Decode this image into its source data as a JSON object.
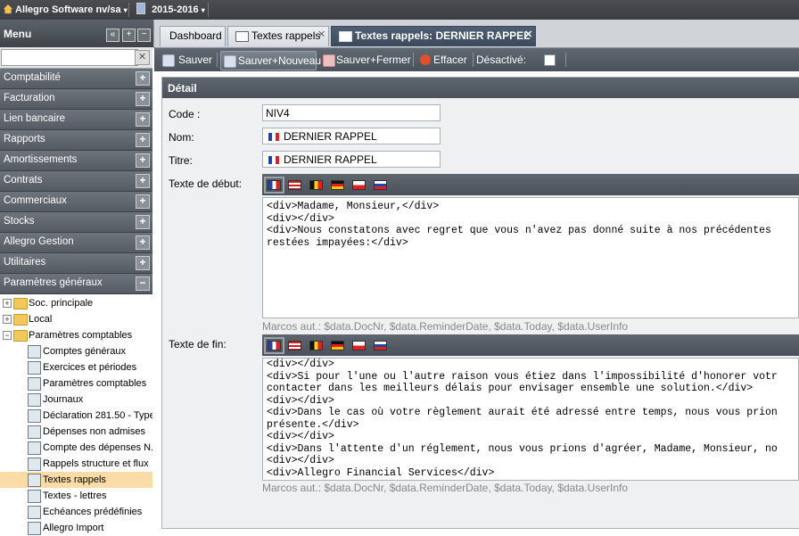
{
  "topbar": {
    "company": "Allegro Software nv/sa",
    "year": "2015-2016"
  },
  "menu": {
    "title": "Menu",
    "search_placeholder": "",
    "categories": [
      "Comptabilité",
      "Facturation",
      "Lien bancaire",
      "Rapports",
      "Amortissements",
      "Contrats",
      "Commerciaux",
      "Stocks",
      "Allegro Gestion",
      "Utilitaires",
      "Paramètres généraux"
    ],
    "tree": [
      {
        "label": "Soc. principale",
        "level": 0,
        "kind": "folder",
        "expander": "+"
      },
      {
        "label": "Local",
        "level": 0,
        "kind": "folder",
        "expander": "+"
      },
      {
        "label": "Paramètres comptables",
        "level": 0,
        "kind": "folder",
        "expander": "−"
      },
      {
        "label": "Comptes généraux",
        "level": 1,
        "kind": "leaf"
      },
      {
        "label": "Exercices et périodes",
        "level": 1,
        "kind": "leaf"
      },
      {
        "label": "Paramètres comptables",
        "level": 1,
        "kind": "leaf"
      },
      {
        "label": "Journaux",
        "level": 1,
        "kind": "leaf"
      },
      {
        "label": "Déclaration 281.50 - Type",
        "level": 1,
        "kind": "leaf"
      },
      {
        "label": "Dépenses non admises",
        "level": 1,
        "kind": "leaf"
      },
      {
        "label": "Compte des dépenses N.",
        "level": 1,
        "kind": "leaf"
      },
      {
        "label": "Rappels structure et flux",
        "level": 1,
        "kind": "leaf"
      },
      {
        "label": "Textes rappels",
        "level": 1,
        "kind": "leaf",
        "selected": true
      },
      {
        "label": "Textes - lettres",
        "level": 1,
        "kind": "leaf"
      },
      {
        "label": "Echéances prédéfinies",
        "level": 1,
        "kind": "leaf"
      },
      {
        "label": "Allegro Import",
        "level": 1,
        "kind": "leaf"
      }
    ]
  },
  "tabs": [
    {
      "label": "Dashboard",
      "active": false
    },
    {
      "label": "Textes rappels",
      "active": false,
      "closable": true
    },
    {
      "label": "Textes rappels: DERNIER RAPPEL",
      "active": true,
      "closable": true
    }
  ],
  "toolbar": {
    "save": "Sauver",
    "save_new": "Sauver+Nouveau",
    "save_close": "Sauver+Fermer",
    "delete": "Effacer",
    "deactivated": "Désactivé:"
  },
  "detail": {
    "title": "Détail",
    "code_label": "Code :",
    "code_value": "NIV4",
    "name_label": "Nom:",
    "name_value": "DERNIER RAPPEL",
    "title_label": "Titre:",
    "title_value": "DERNIER RAPPEL",
    "start_label": "Texte de début:",
    "start_text": "<div>Madame, Monsieur,</div>\n<div></div>\n<div>Nous constatons avec regret que vous n'avez pas donné suite à nos précédentes\nrestées impayées:</div>",
    "end_label": "Texte de fin:",
    "end_text": "<div></div>\n<div>Si pour l'une ou l'autre raison vous étiez dans l'impossibilité d'honorer votr\ncontacter dans les meilleurs délais pour envisager ensemble une solution.</div>\n<div></div>\n<div>Dans le cas où votre règlement aurait été adressé entre temps, nous vous prion\nprésente.</div>\n<div></div>\n<div>Dans l'attente d'un réglement, nous vous prions d'agréer, Madame, Monsieur, no\n<div></div>\n<div>Allegro Financial Services</div>",
    "macros": "Marcos aut.: $data.DocNr, $data.ReminderDate, $data.Today, $data.UserInfo"
  },
  "languages": [
    "fr",
    "en",
    "be",
    "de",
    "cz",
    "sk"
  ],
  "colors": {
    "accent_dark": "#4a515a",
    "selection": "#fbdca7"
  }
}
